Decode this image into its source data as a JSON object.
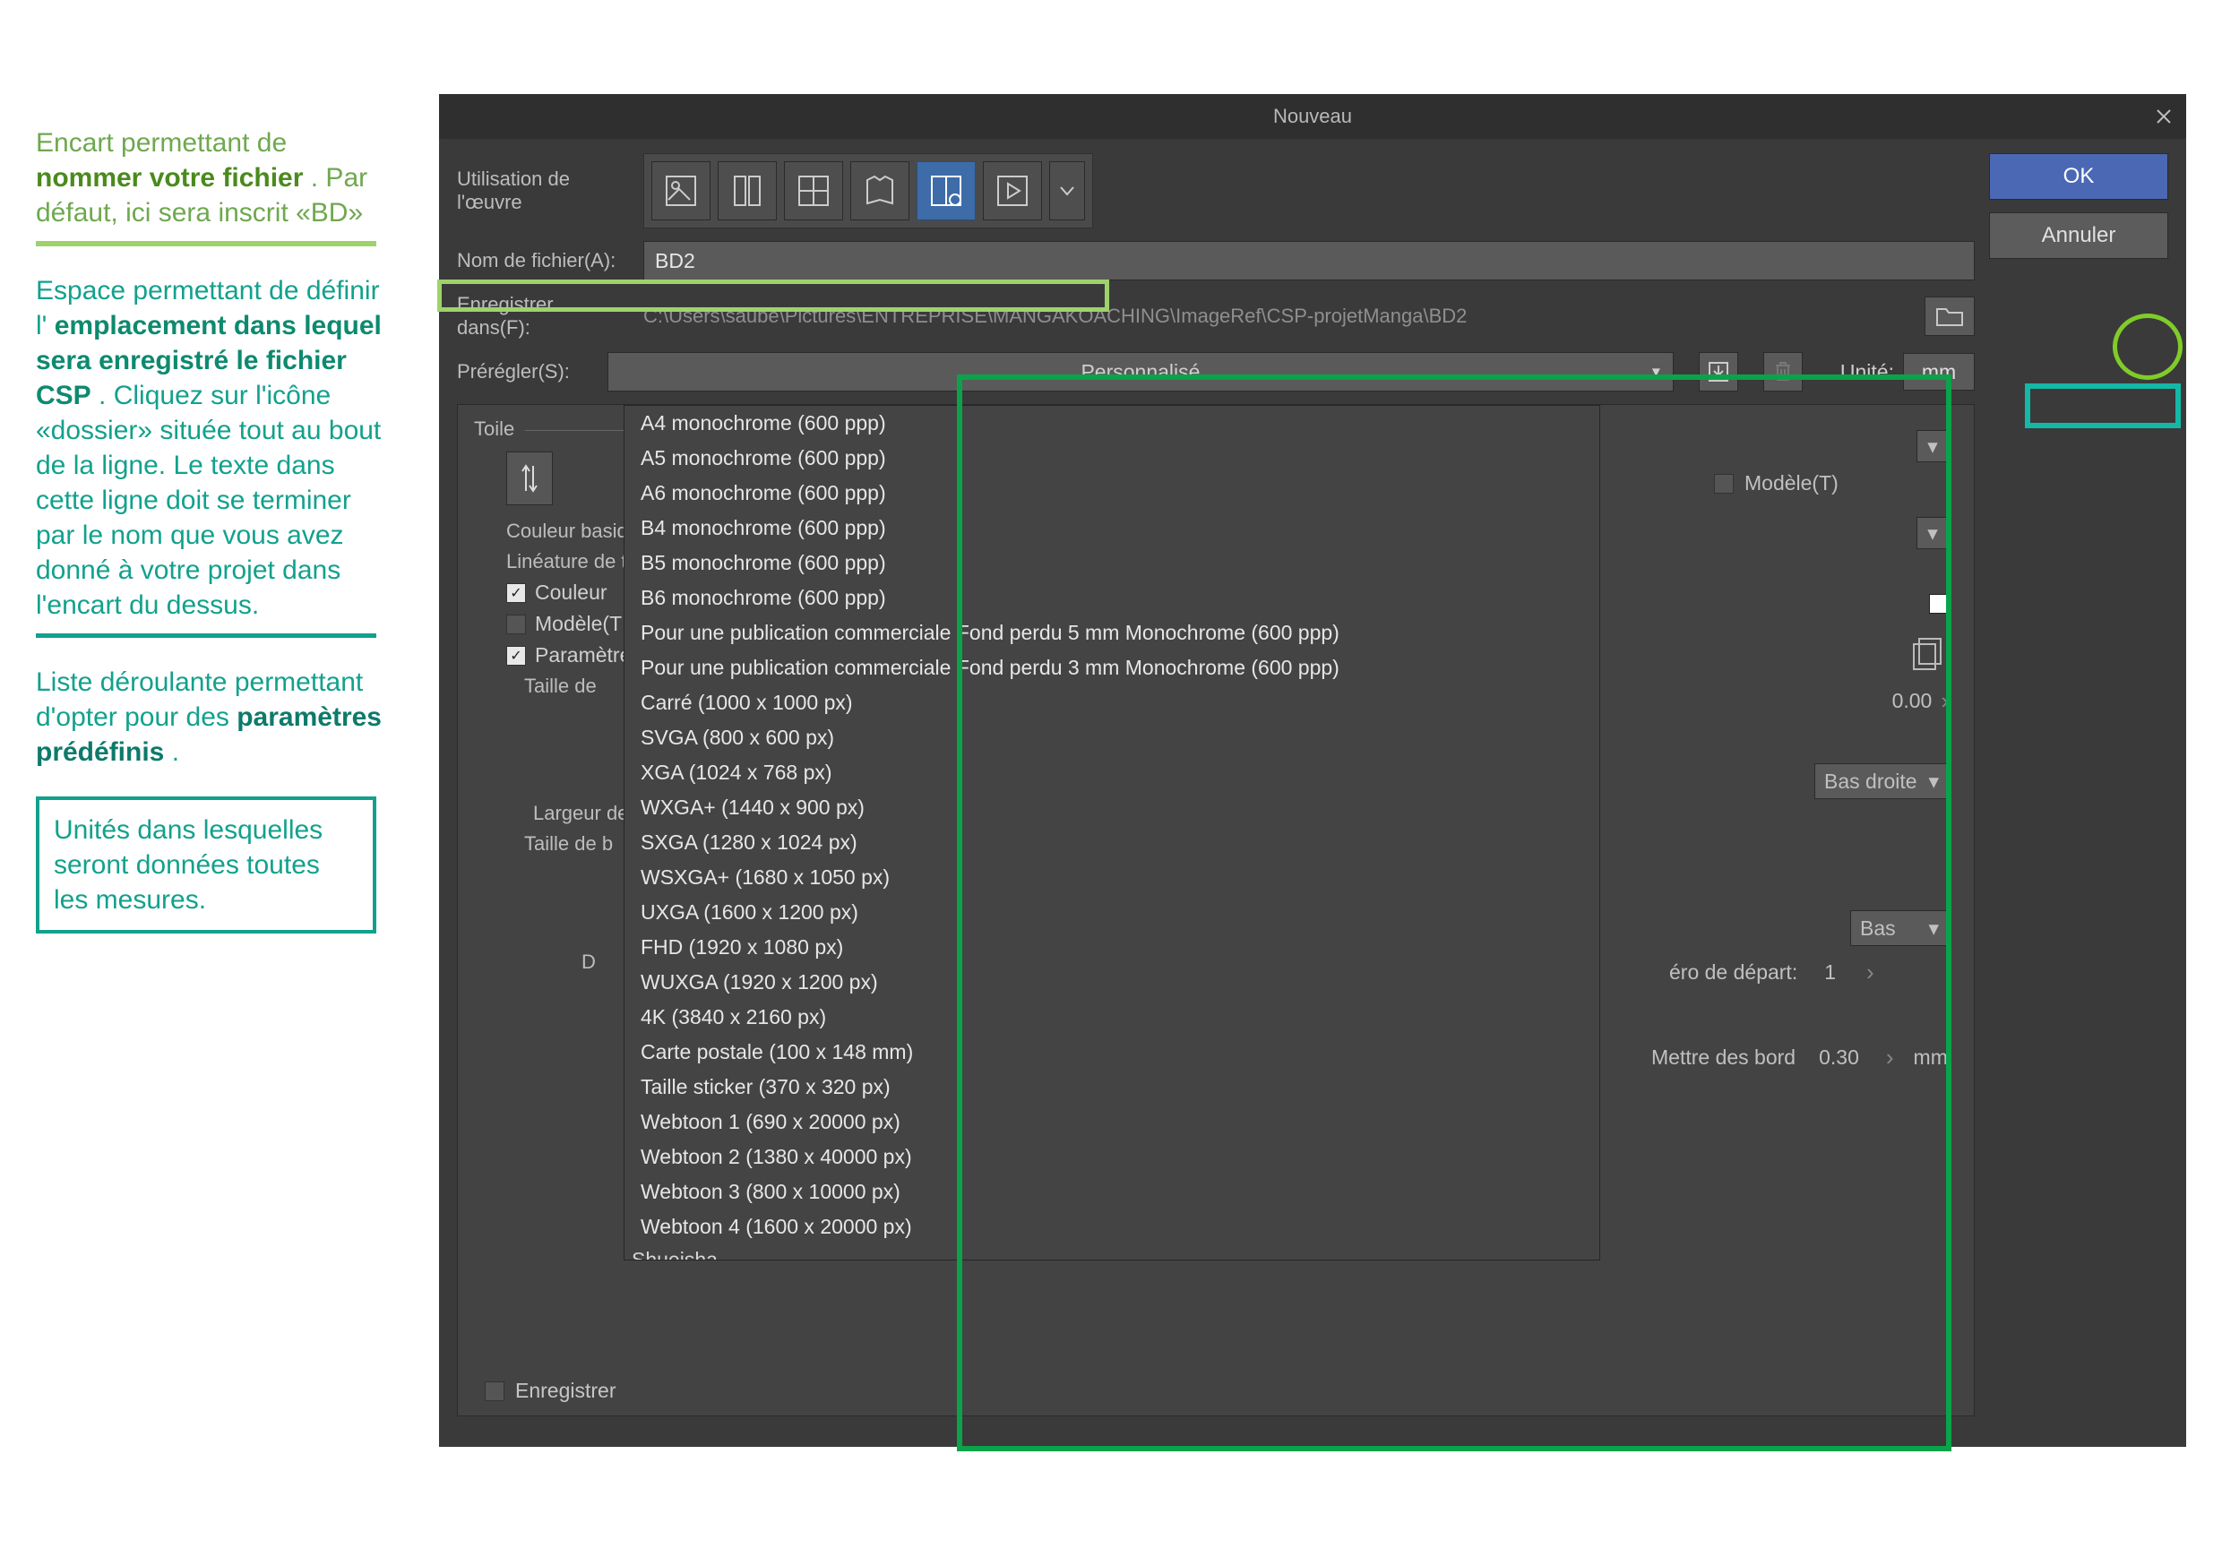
{
  "annotations": {
    "box1_l1": "Encart permettant de ",
    "box1_bold": "nommer votre fichier",
    "box1_l2": ". Par défaut, ici sera inscrit «BD»",
    "box2_l1": "Espace permettant de définir l'",
    "box2_bold1": "emplacement dans lequel sera enregistré le fichier CSP",
    "box2_l2": ". Cliquez sur l'icône «dossier» située tout au bout de la ligne. Le texte dans cette ligne doit se terminer par le nom que vous avez donné à votre projet dans l'encart du dessus.",
    "box3_l1": "Liste déroulante permettant d'opter pour des ",
    "box3_bold": "paramètres prédéfinis",
    "box3_l2": ".",
    "box4": "Unités dans lesquelles seront données toutes les mesures."
  },
  "window": {
    "title": "Nouveau",
    "ok": "OK",
    "cancel": "Annuler",
    "usage_label": "Utilisation de l'œuvre",
    "filename_label": "Nom de fichier(A):",
    "filename_value": "BD2",
    "savein_label": "Enregistrer dans(F):",
    "savein_path": "C:\\Users\\saube\\Pictures\\ENTREPRISE\\MANGAKOACHING\\ImageRef\\CSP-projetManga\\BD2",
    "preset_label": "Prérégler(S):",
    "preset_selected": "Personnalisé",
    "unit_label": "Unité:",
    "unit_value": "mm",
    "panel_title": "Toile",
    "couleur_basique": "Couleur basique",
    "lineature": "Linéature de tr",
    "couleur_check": "Couleur",
    "modele_check": "Modèle(T",
    "params_check": "Paramètres",
    "taille_de": "Taille de ",
    "largeur_de": "Largeur de ",
    "taille_de_b": "Taille de b",
    "d_label": "D",
    "save_check": "Enregistrer",
    "modele_right": "Modèle(T)",
    "val_000": "0.00",
    "sel_bas_droite": "Bas droite",
    "sel_bas": "Bas",
    "numero_depart_label": "éro de départ:",
    "numero_depart_val": "1",
    "mettre_bord_label": "Mettre des bord",
    "mettre_bord_val": "0.30",
    "mm_suffix": "mm"
  },
  "presets": [
    "A4 monochrome (600 ppp)",
    "A5 monochrome (600 ppp)",
    "A6 monochrome (600 ppp)",
    "B4 monochrome (600 ppp)",
    "B5 monochrome (600 ppp)",
    "B6 monochrome (600 ppp)",
    "Pour une publication commerciale  Fond perdu 5 mm Monochrome (600 ppp)",
    "Pour une publication commerciale  Fond perdu 3 mm Monochrome (600 ppp)",
    "Carré (1000 x 1000 px)",
    "SVGA (800 x 600 px)",
    "XGA (1024 x 768 px)",
    "WXGA+ (1440 x 900 px)",
    "SXGA (1280 x 1024 px)",
    "WSXGA+ (1680 x 1050 px)",
    "UXGA (1600 x 1200 px)",
    "FHD (1920 x 1080 px)",
    "WUXGA (1920 x 1200 px)",
    "4K (3840 x 2160 px)",
    "Carte postale (100 x 148 mm)",
    "Taille sticker (370 x 320 px)",
    "Webtoon 1 (690 x 20000 px)",
    "Webtoon 2 (1380 x 40000 px)",
    "Webtoon 3 (800 x 10000 px)",
    "Webtoon 4 (1600 x 20000 px)"
  ],
  "preset_divider": "Shueisha"
}
